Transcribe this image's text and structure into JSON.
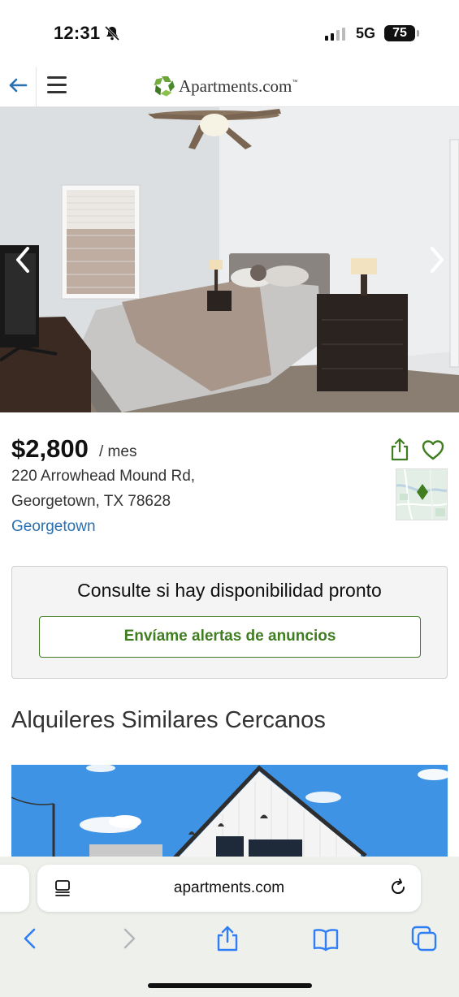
{
  "status_bar": {
    "time": "12:31",
    "network": "5G",
    "battery": "75"
  },
  "header": {
    "logo_text": "Apartments.com",
    "logo_tm": "™"
  },
  "listing": {
    "price": "$2,800",
    "period": "/ mes",
    "address_line1": "220 Arrowhead Mound Rd,",
    "address_line2": "Georgetown, TX 78628",
    "neighborhood": "Georgetown"
  },
  "availability": {
    "message": "Consulte si hay disponibilidad pronto",
    "button_label": "Envíame alertas de anuncios"
  },
  "similar": {
    "title": "Alquileres Similares Cercanos"
  },
  "browser": {
    "url": "apartments.com"
  },
  "colors": {
    "brand_green": "#3f7d20",
    "link_blue": "#2a6fb0",
    "ios_blue": "#2f7ef6"
  }
}
